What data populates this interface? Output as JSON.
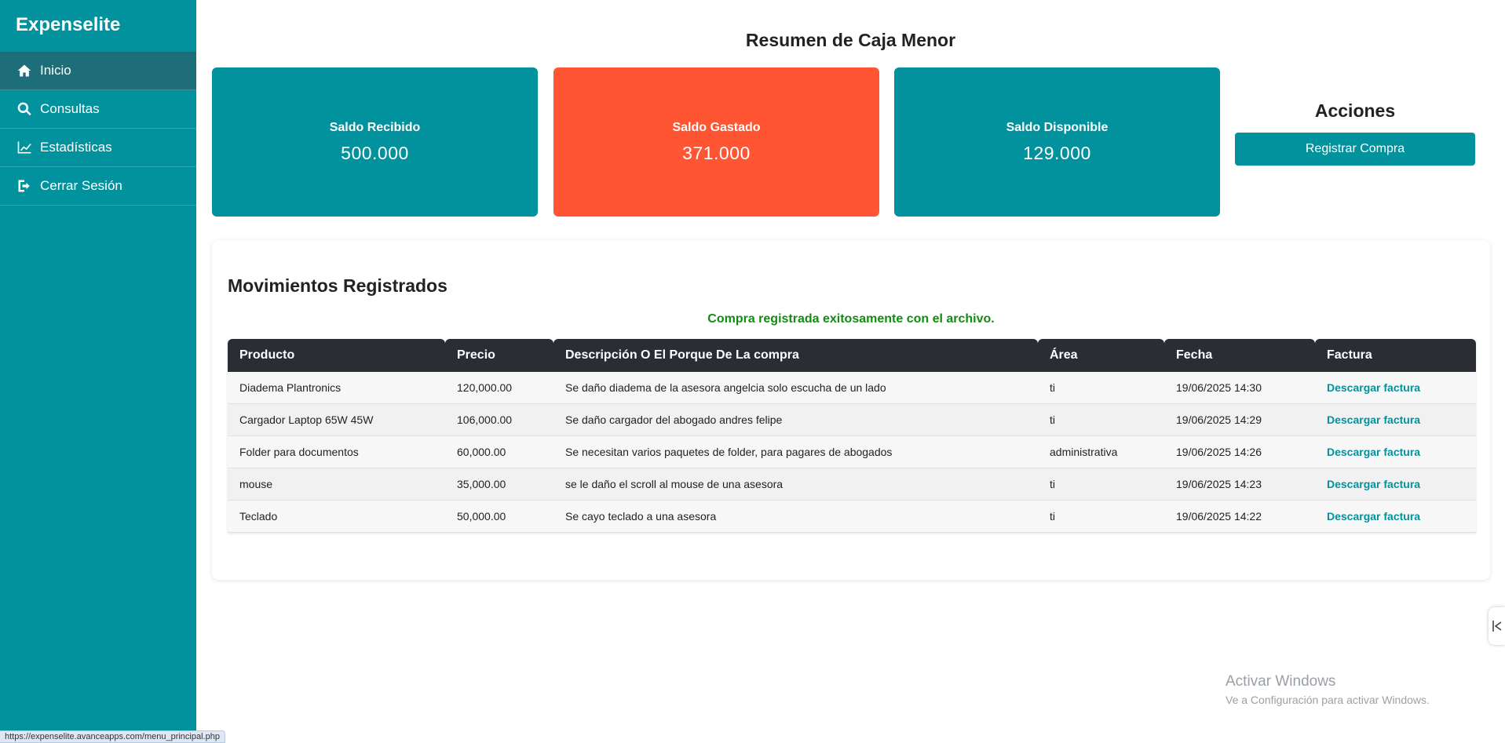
{
  "app": {
    "title": "Expenselite"
  },
  "sidebar": {
    "items": [
      {
        "label": "Inicio",
        "icon": "home-icon",
        "active": true
      },
      {
        "label": "Consultas",
        "icon": "search-icon",
        "active": false
      },
      {
        "label": "Estadísticas",
        "icon": "line-chart-icon",
        "active": false
      },
      {
        "label": "Cerrar Sesión",
        "icon": "sign-out-icon",
        "active": false
      }
    ]
  },
  "summary": {
    "title": "Resumen de Caja Menor",
    "cards": [
      {
        "label": "Saldo Recibido",
        "value": "500.000",
        "color": "#01929d"
      },
      {
        "label": "Saldo Gastado",
        "value": "371.000",
        "color": "#ff5533"
      },
      {
        "label": "Saldo Disponible",
        "value": "129.000",
        "color": "#01929d"
      }
    ]
  },
  "actions": {
    "title": "Acciones",
    "button_label": "Registrar Compra"
  },
  "movements": {
    "title": "Movimientos Registrados",
    "message": "Compra registrada exitosamente con el archivo.",
    "columns": [
      "Producto",
      "Precio",
      "Descripción O El Porque De La compra",
      "Área",
      "Fecha",
      "Factura"
    ],
    "rows": [
      {
        "producto": "Diadema Plantronics",
        "precio": "120,000.00",
        "descripcion": "Se daño diadema de la asesora angelcia solo escucha de un lado",
        "area": "ti",
        "fecha": "19/06/2025 14:30",
        "factura": "Descargar factura"
      },
      {
        "producto": "Cargador Laptop 65W 45W",
        "precio": "106,000.00",
        "descripcion": "Se daño cargador del abogado andres felipe",
        "area": "ti",
        "fecha": "19/06/2025 14:29",
        "factura": "Descargar factura"
      },
      {
        "producto": "Folder para documentos",
        "precio": "60,000.00",
        "descripcion": "Se necesitan varios paquetes de folder, para pagares de abogados",
        "area": "administrativa",
        "fecha": "19/06/2025 14:26",
        "factura": "Descargar factura"
      },
      {
        "producto": "mouse",
        "precio": "35,000.00",
        "descripcion": "se le daño el scroll al mouse de una asesora",
        "area": "ti",
        "fecha": "19/06/2025 14:23",
        "factura": "Descargar factura"
      },
      {
        "producto": "Teclado",
        "precio": "50,000.00",
        "descripcion": "Se cayo teclado a una asesora",
        "area": "ti",
        "fecha": "19/06/2025 14:22",
        "factura": "Descargar factura"
      }
    ]
  },
  "watermark": {
    "line1": "Activar Windows",
    "line2": "Ve a Configuración para activar Windows."
  },
  "statusbar": {
    "url": "https://expenselite.avanceapps.com/menu_principal.php"
  },
  "colors": {
    "accent": "#01929d",
    "spent": "#ff5533",
    "table_header": "#2a2d33",
    "success": "#138a13"
  }
}
